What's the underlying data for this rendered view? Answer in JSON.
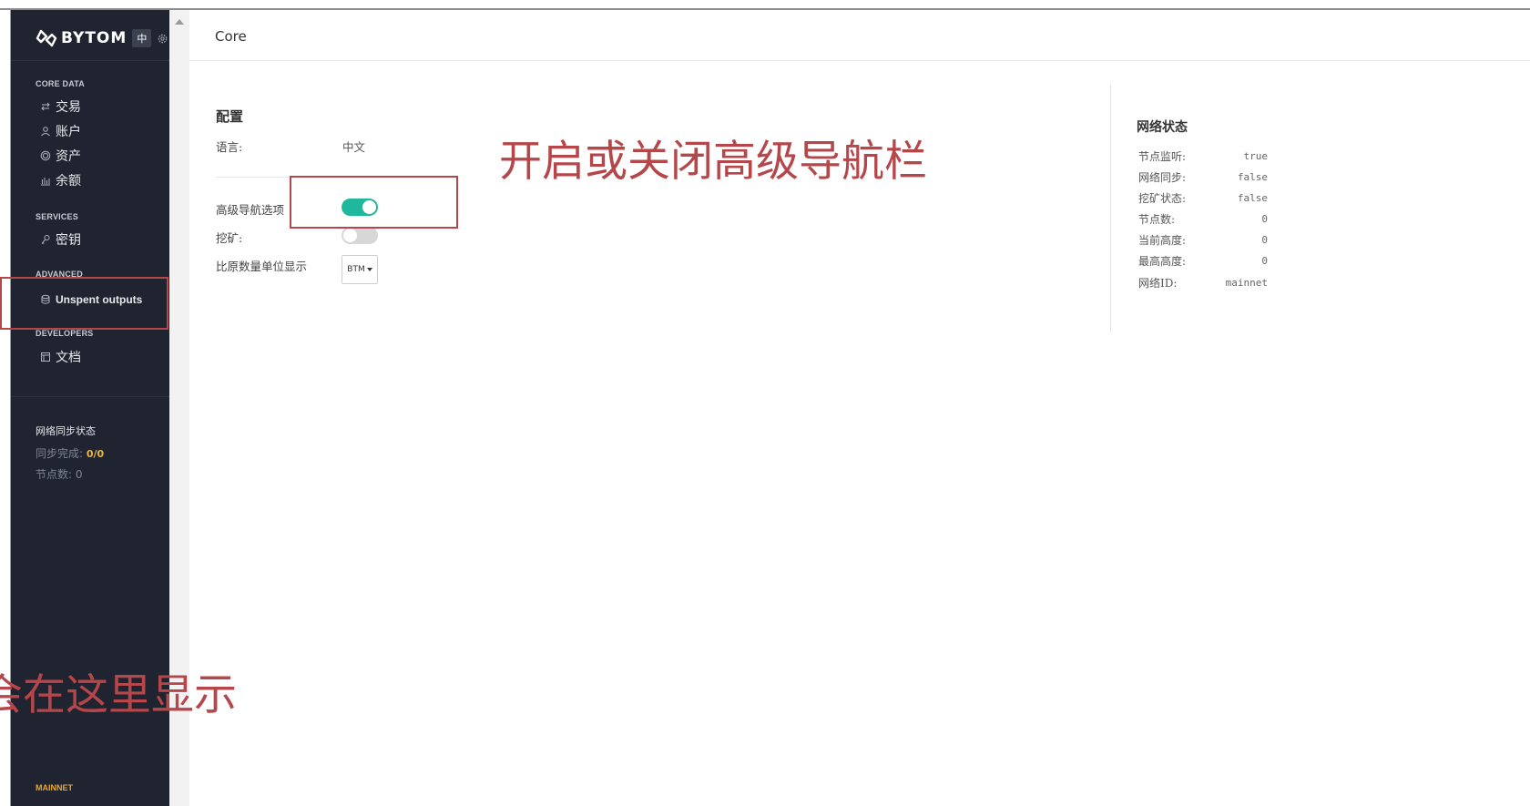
{
  "sidebar": {
    "brand": "BYTOM",
    "lang_chip": "中",
    "sections": {
      "core_data": "CORE DATA",
      "services": "SERVICES",
      "advanced": "ADVANCED",
      "developers": "DEVELOPERS"
    },
    "items": {
      "transactions": "交易",
      "accounts": "账户",
      "assets": "资产",
      "balances": "余额",
      "keys": "密钥",
      "unspent_outputs": "Unspent outputs",
      "docs": "文档"
    },
    "sync": {
      "title": "网络同步状态",
      "complete_label": "同步完成: ",
      "complete_value": "0/0",
      "peers_label": "节点数: ",
      "peers_value": "0"
    },
    "network": "MAINNET"
  },
  "header": {
    "title": "Core"
  },
  "config": {
    "title": "配置",
    "language_label": "语言:",
    "language_value": "中文",
    "advanced_nav_label": "高级导航选项",
    "advanced_nav_on": true,
    "mining_label": "挖矿:",
    "mining_on": false,
    "unit_label": "比原数量单位显示",
    "unit_value": "BTM"
  },
  "network_status": {
    "title": "网络状态",
    "rows": [
      {
        "label": "节点监听:",
        "value": "true"
      },
      {
        "label": "网络同步:",
        "value": "false"
      },
      {
        "label": "挖矿状态:",
        "value": "false"
      },
      {
        "label": "节点数:",
        "value": "0"
      },
      {
        "label": "当前高度:",
        "value": "0"
      },
      {
        "label": "最高高度:",
        "value": "0"
      },
      {
        "label": "网络ID:",
        "value": "mainnet"
      }
    ]
  },
  "annotations": {
    "toggle_hint": "开启或关闭高级导航栏",
    "sidebar_hint": "会在这里显示"
  },
  "colors": {
    "sidebar_bg": "#1f2430",
    "toggle_on": "#20b89c",
    "annotation": "#b5474b",
    "accent_yellow": "#e9b64a"
  }
}
